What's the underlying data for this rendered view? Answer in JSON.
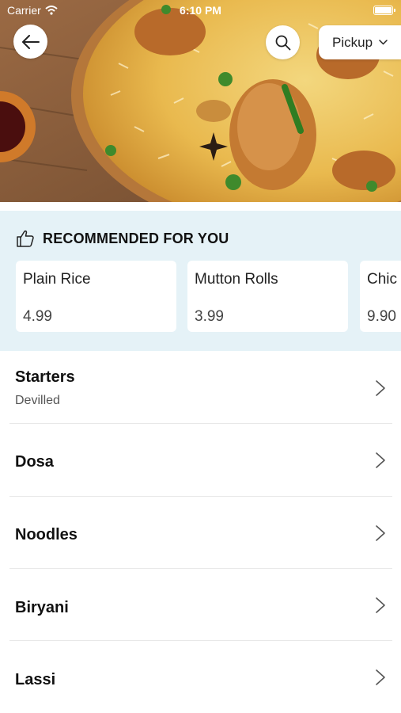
{
  "status_bar": {
    "carrier": "Carrier",
    "time": "6:10 PM"
  },
  "header": {
    "back_icon": "arrow-left-icon",
    "search_icon": "search-icon",
    "order_mode": "Pickup"
  },
  "recommended": {
    "icon": "thumbs-up-icon",
    "title": "RECOMMENDED FOR YOU",
    "items": [
      {
        "name": "Plain Rice",
        "price": "4.99"
      },
      {
        "name": "Mutton Rolls",
        "price": "3.99"
      },
      {
        "name": "Chic",
        "price": "9.90"
      }
    ]
  },
  "categories": [
    {
      "name": "Starters",
      "subtitle": "Devilled"
    },
    {
      "name": "Dosa"
    },
    {
      "name": "Noodles"
    },
    {
      "name": "Biryani"
    },
    {
      "name": "Lassi"
    }
  ],
  "colors": {
    "recommended_bg": "#e5f2f7",
    "card_bg": "#ffffff"
  }
}
